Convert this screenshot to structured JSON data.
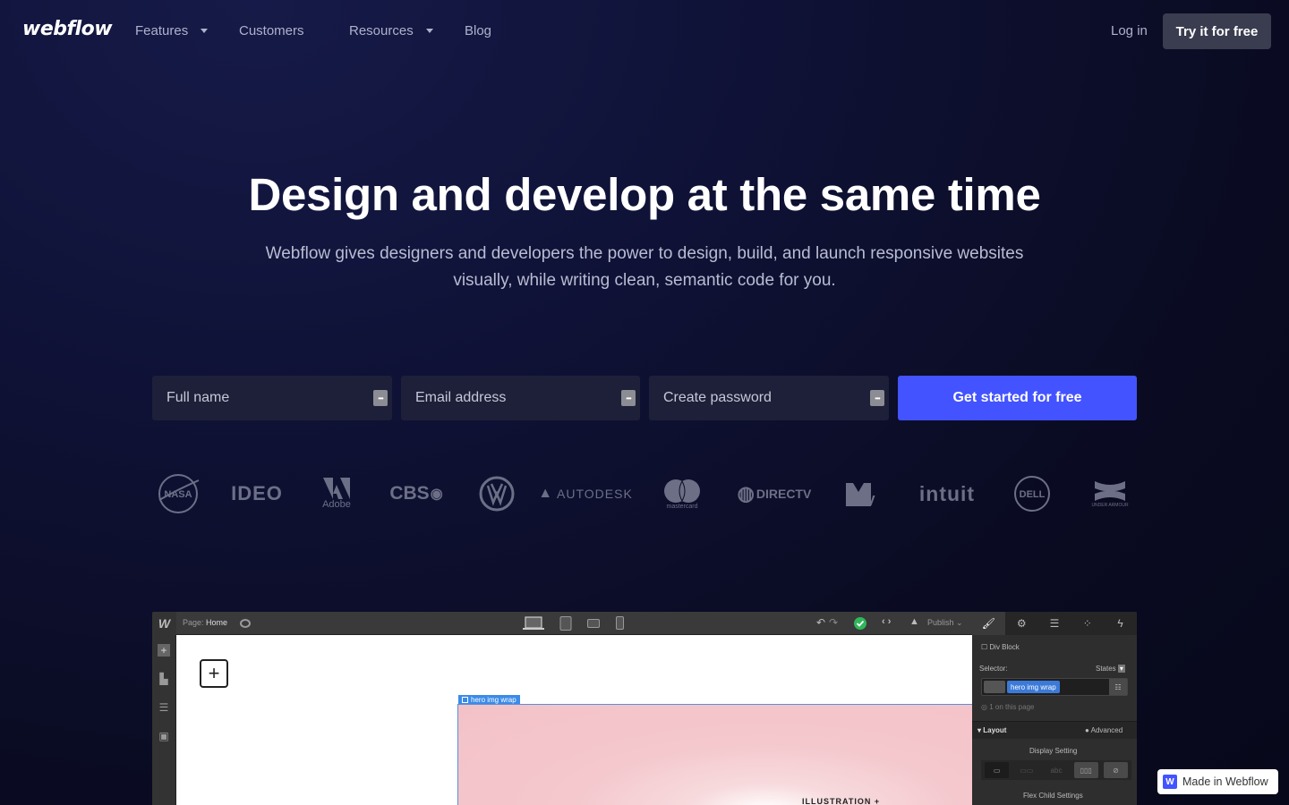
{
  "nav": {
    "logo": "webflow",
    "items": [
      {
        "label": "Features",
        "has_dropdown": true
      },
      {
        "label": "Customers",
        "has_dropdown": false
      },
      {
        "label": "Resources",
        "has_dropdown": true
      },
      {
        "label": "Blog",
        "has_dropdown": false
      }
    ],
    "login": "Log in",
    "cta": "Try it for free"
  },
  "hero": {
    "title": "Design and develop at the same time",
    "subtitle": "Webflow gives designers and developers the power to design, build, and launch responsive websites visually, while writing clean, semantic code for you."
  },
  "signup": {
    "fields": [
      {
        "placeholder": "Full name",
        "value": ""
      },
      {
        "placeholder": "Email address",
        "value": ""
      },
      {
        "placeholder": "Create password",
        "value": ""
      }
    ],
    "submit": "Get started for free"
  },
  "logos": [
    "NASA",
    "IDEO",
    "Adobe",
    "CBS",
    "Volkswagen",
    "AUTODESK",
    "mastercard",
    "DIRECTV",
    "MTV",
    "intuit",
    "DELL",
    "UNDER ARMOUR"
  ],
  "editor": {
    "logo": "W",
    "page_label": "Page:",
    "page_name": "Home",
    "publish": "Publish",
    "element_type": "Div Block",
    "selector_label": "Selector:",
    "states_label": "States",
    "selector_class": "hero img wrap",
    "on_page": "1 on this page",
    "layout_label": "Layout",
    "advanced_label": "Advanced",
    "display_setting": "Display Setting",
    "flex_child": "Flex Child Settings",
    "selection_tag": "hero img wrap",
    "canvas_text": "ILLUSTRATION +"
  },
  "badge": {
    "label": "Made in Webflow"
  },
  "colors": {
    "accent": "#4353ff",
    "background": "#0f1236",
    "editor_selection": "#3b8be8",
    "publish_status": "#2fb75a"
  }
}
